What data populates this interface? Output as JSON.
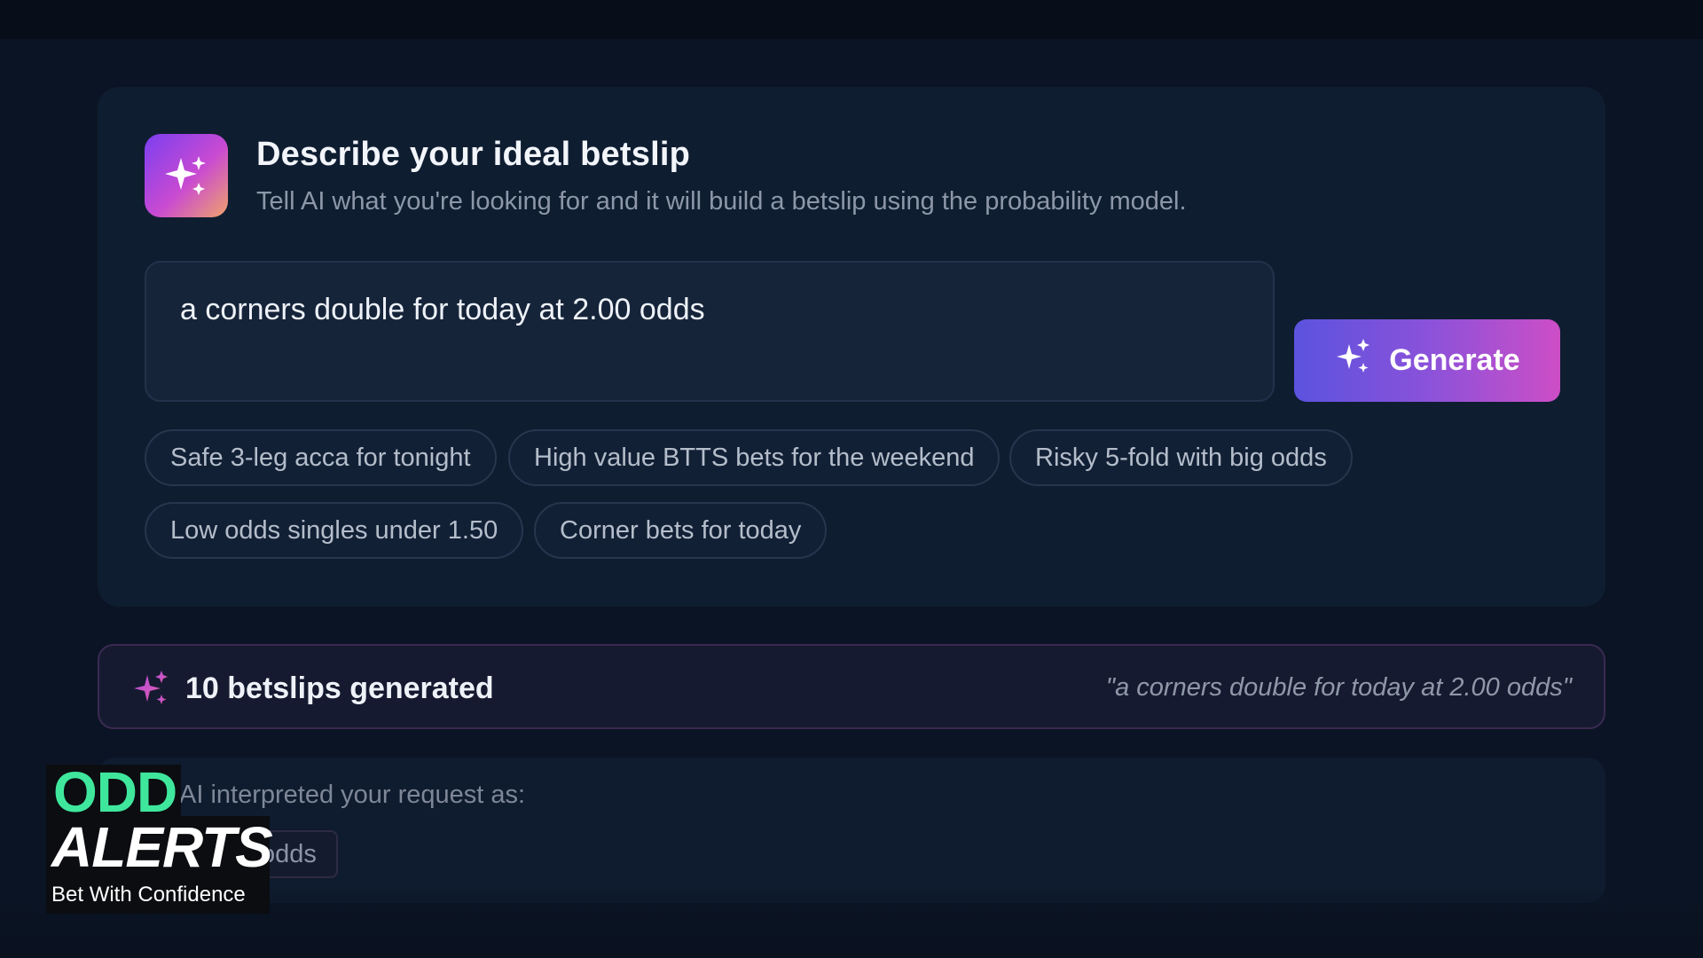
{
  "prompt_card": {
    "title": "Describe your ideal betslip",
    "subtitle": "Tell AI what you're looking for and it will build a betslip using the probability model.",
    "input_value": "a corners double for today at 2.00 odds",
    "generate_label": "Generate",
    "suggestions": [
      "Safe 3-leg acca for tonight",
      "High value BTTS bets for the weekend",
      "Risky 5-fold with big odds",
      "Low odds singles under 1.50",
      "Corner bets for today"
    ]
  },
  "results": {
    "count_text": "10 betslips generated",
    "query_text": "\"a corners double for today at 2.00 odds\""
  },
  "interpretation": {
    "label": "AI interpreted your request as:",
    "tag": "odds"
  },
  "watermark": {
    "line1": "ODD",
    "line2": "ALERTS",
    "tagline": "Bet With Confidence"
  },
  "colors": {
    "accent_start": "#5b53de",
    "accent_end": "#cd4ec6",
    "logo_green": "#3fe79d",
    "background": "#0b1424"
  },
  "icons": {
    "badge": "sparkles-icon",
    "generate": "sparkles-icon",
    "results": "sparkles-icon"
  }
}
